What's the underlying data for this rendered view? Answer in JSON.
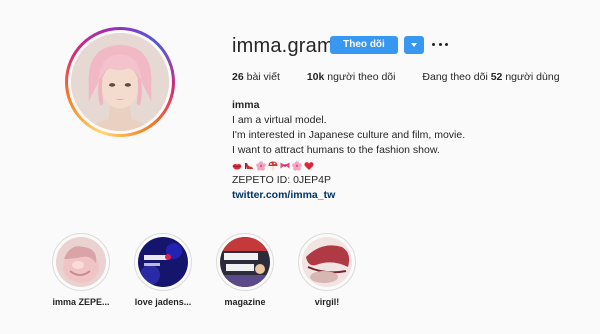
{
  "profile": {
    "username": "imma.gram",
    "follow_label": "Theo dõi",
    "avatar_icon": "profile-photo-icon"
  },
  "stats": {
    "posts_count": "26",
    "posts_label": "bài viết",
    "followers_count": "10k",
    "followers_label": "người theo dõi",
    "following_prefix": "Đang theo dõi",
    "following_count": "52",
    "following_label": "người dùng"
  },
  "bio": {
    "name": "imma",
    "line1": "I am a virtual model.",
    "line2": "I'm interested in Japanese culture and film, movie.",
    "line3": "I want to attract humans to the fashion show.",
    "emojis": [
      "lips-emoji",
      "high-heel-emoji",
      "cherry-blossom-emoji",
      "mushroom-emoji",
      "ribbon-emoji",
      "cherry-blossom-emoji",
      "heart-emoji"
    ],
    "zepeto": "ZEPETO ID: 0JEP4P",
    "link": "twitter.com/imma_tw"
  },
  "highlights": [
    {
      "label": "imma ZEPE..."
    },
    {
      "label": "love jadens..."
    },
    {
      "label": "magazine"
    },
    {
      "label": "virgil!"
    }
  ],
  "colors": {
    "accent": "#3897f0",
    "link": "#003569",
    "text": "#262626",
    "background": "#fafafa"
  }
}
